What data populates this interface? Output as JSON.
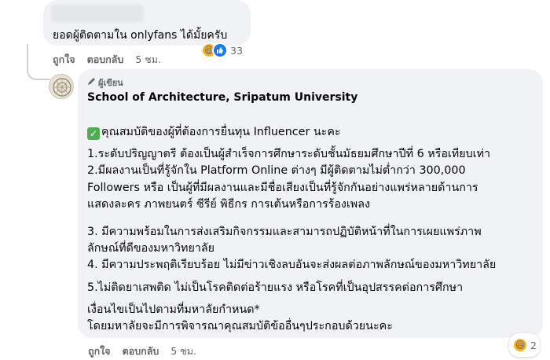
{
  "comment1": {
    "text": "ยอดผู้ติดตามใน onlyfans ได้มั้ยครับ",
    "like_label": "ถูกใจ",
    "reply_label": "ตอบกลับ",
    "time": "5 ชม.",
    "reaction_count": "33",
    "reaction_icons": [
      "haha-icon",
      "like-icon"
    ]
  },
  "reply": {
    "badge": "ผู้เขียน",
    "author": "School of Architecture, Sripatum University",
    "lines": [
      "คุณสมบัติของผู้ที่ต้องการยื่นทุน Influencer นะคะ",
      "1.ระดับปริญญาตรี ต้องเป็นผู้สำเร็จการศึกษาระดับชั้นมัธยมศึกษาปีที่ 6 หรือเทียบเท่า",
      "2.มีผลงานเป็นที่รู้จักใน Platform Online ต่างๆ มีผู้ติดตามไม่ต่ำกว่า 300,000",
      "Followers หรือ เป็นผู้ที่มีผลงานและมีชื่อเสียงเป็นที่รู้จักกันอย่างแพร่หลายด้านการ",
      "แสดงละคร ภาพยนตร์ ซีรีย์ พิธีกร การเต้นหรือการร้องเพลง",
      "3. มีความพร้อมในการส่งเสริมกิจกรรมและสามารถปฏิบัติหน้าที่ในการเผยแพร่ภาพ",
      "ลักษณ์ที่ดีของมหาวิทยาลัย",
      "4. มีความประพฤติเรียบร้อย ไม่มีข่าวเชิงลบอันจะส่งผลต่อภาพลักษณ์ของมหาวิทยาลัย",
      "5.ไม่ติดยาเสพติด ไม่เป็นโรคติดต่อร้ายแรง หรือโรคที่เป็นอุปสรรคต่อการศึกษา",
      "เงื่อนไขเป็นไปตามที่มหาลัยกำหนด*",
      "โดยมหาลัยจะมีการพิจารณาคุณสมบัติข้ออื่นๆประกอบด้วยนะคะ"
    ],
    "like_label": "ถูกใจ",
    "reply_label": "ตอบกลับ",
    "time": "5 ชม.",
    "reaction_count": "2",
    "reaction_icons": [
      "haha-icon"
    ]
  }
}
